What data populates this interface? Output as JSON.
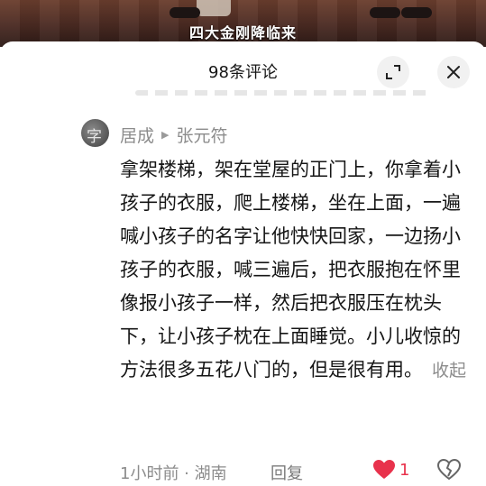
{
  "video": {
    "subtitle": "四大金刚降临来"
  },
  "sheet": {
    "title": "98条评论"
  },
  "comment": {
    "author": "居成",
    "reply_to": "张元符",
    "avatar_glyph": "字",
    "text": "拿架楼梯，架在堂屋的正门上，你拿着小孩子的衣服，爬上楼梯，坐在上面，一遍喊小孩子的名字让他快快回家，一边扬小孩子的衣服，喊三遍后，把衣服抱在怀里像报小孩子一样，然后把衣服压在枕头下，让小孩子枕在上面睡觉。小儿收惊的方法很多五花八门的，但是很有用。",
    "collapse_label": "收起",
    "time_location": "1小时前 · 湖南",
    "reply_label": "回复",
    "like_count": "1"
  },
  "colors": {
    "like": "#e8324c",
    "secondary_text": "#8c8c8c",
    "primary_text": "#161616"
  },
  "icons": {
    "expand": "expand-icon",
    "close": "close-icon",
    "like": "heart-filled-icon",
    "dislike": "heart-broken-icon",
    "arrow": "right-triangle-icon"
  }
}
